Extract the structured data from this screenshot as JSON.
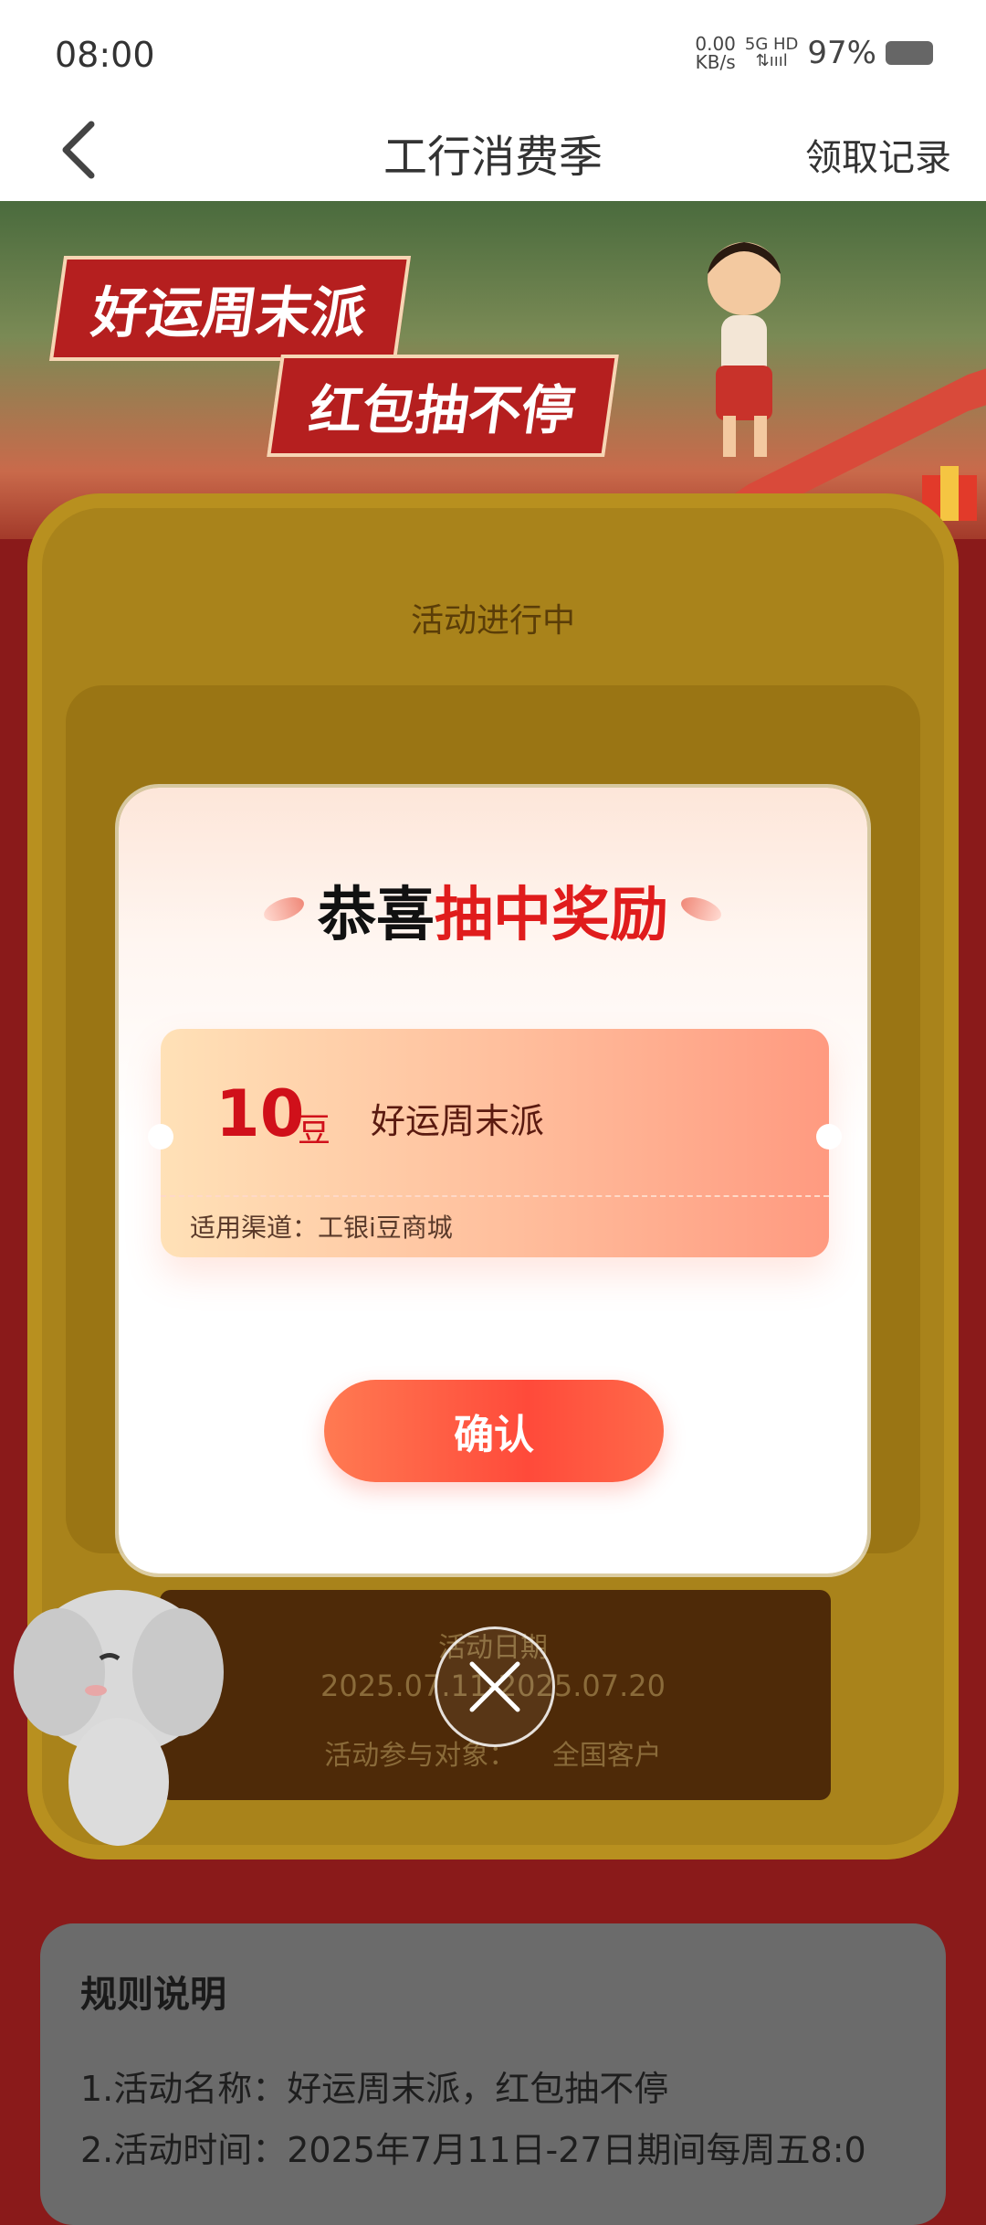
{
  "status_bar": {
    "time": "08:00",
    "net_speed_top": "0.00",
    "net_speed_bottom": "KB/s",
    "signal_top": "5G HD",
    "signal_bottom": "⇅ıııl",
    "battery": "97%"
  },
  "nav": {
    "title": "工行消费季",
    "right_label": "领取记录"
  },
  "hero": {
    "line1": "好运周末派",
    "line2": "红包抽不停"
  },
  "machine": {
    "status": "活动进行中",
    "info": {
      "label": "活动日期",
      "date_range": "2025.07.11-2025.07.20",
      "target_label": "活动参与对象：",
      "target_value": "全国客户"
    }
  },
  "rules": {
    "title": "规则说明",
    "lines": [
      "1.活动名称：好运周末派，红包抽不停",
      "2.活动时间：2025年7月11日-27日期间每周五8:0"
    ]
  },
  "modal": {
    "title_prefix": "恭喜",
    "title_accent": "抽中奖励",
    "ticket": {
      "amount": "10",
      "unit": "豆",
      "name": "好运周末派",
      "channel": "适用渠道：工银i豆商城"
    },
    "confirm_label": "确认"
  },
  "colors": {
    "accent_red": "#e01c1c",
    "button_red": "#ff4a3a",
    "ticket_gradient_start": "#ffe1b7",
    "ticket_gradient_end": "#ff9a80"
  }
}
